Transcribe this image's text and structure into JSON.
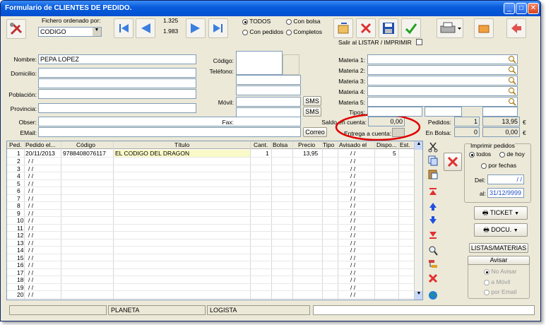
{
  "window": {
    "title": "Formulario de CLIENTES DE PEDIDO."
  },
  "toolbar": {
    "sort_label": "Fichero ordenado por:",
    "sort_value": "CODIGO",
    "record_current": "1.325",
    "record_total": "1.983",
    "filter": {
      "todos": "TODOS",
      "con_bolsa": "Con bolsa",
      "con_pedidos": "Con pedidos",
      "completos": "Completos"
    },
    "exit_print_label": "Salir al LISTAR / IMPRIMIR"
  },
  "form": {
    "nombre_label": "Nombre:",
    "nombre": "PEPA LOPEZ",
    "domicilio_label": "Domicilio:",
    "poblacion_label": "Población:",
    "provincia_label": "Provincia:",
    "obser_label": "Obser:",
    "email_label": "EMail:",
    "codigo_label": "Código:",
    "telefono_label": "Teléfono:",
    "movil_label": "Móvil:",
    "fax_label": "Fax:",
    "sms1": "SMS",
    "sms2": "SMS",
    "correo": "Correo",
    "saldo_label": "Saldo en cuenta:",
    "saldo": "0,00",
    "entrega_label": "Entrega a cuenta:",
    "materia1": "Materia 1:",
    "materia2": "Materia 2:",
    "materia3": "Materia 3:",
    "materia4": "Materia 4:",
    "materia5": "Materia 5:",
    "tipos_label": "Tipos:",
    "pedidos_label": "Pedidos:",
    "pedidos_count": "1",
    "pedidos_amount": "13,95",
    "pedidos_currency": "€",
    "enbolsa_label": "En Bolsa:",
    "enbolsa_count": "0",
    "enbolsa_amount": "0,00",
    "enbolsa_currency": "€"
  },
  "grid": {
    "headers": [
      "Ped.",
      "Pedido el...",
      "Código",
      "Título",
      "Cant.",
      "Bolsa",
      "Precio",
      "Tipo",
      "Avisado el",
      "Dispo...",
      "Est."
    ],
    "first_row": {
      "num": "1",
      "date": "20/11/2013",
      "code": "9788408076117",
      "title": "EL CODIGO DEL DRAGON",
      "cant": "1",
      "precio": "13,95",
      "avisado": "/ /",
      "dispo": "5"
    },
    "row_numbers": [
      "2",
      "3",
      "4",
      "5",
      "6",
      "7",
      "8",
      "9",
      "10",
      "11",
      "12",
      "13",
      "14",
      "15",
      "16",
      "17",
      "18",
      "19",
      "20"
    ],
    "empty_date": "/ /"
  },
  "right_panel": {
    "imprimir_title": "Imprimir pedidos",
    "todos": "todos",
    "de_hoy": "de hoy",
    "por_fechas": "por fechas",
    "del_label": "Del:",
    "del_value": "/ /",
    "al_label": "al:",
    "al_value": "31/12/9999",
    "ticket": "TICKET",
    "docu": "DOCU.",
    "listas": "LISTAS/MATERIAS",
    "avisar_title": "Avisar",
    "no_avisar": "No Avisar",
    "a_movil": "a Móvil",
    "por_email": "por Email"
  },
  "status": {
    "publisher": "PLANETA",
    "distributor": "LOGISTA"
  },
  "colors": {
    "title_bg": "#0a5ddc",
    "highlight": "#fafac8",
    "accent_red": "#e00000"
  }
}
